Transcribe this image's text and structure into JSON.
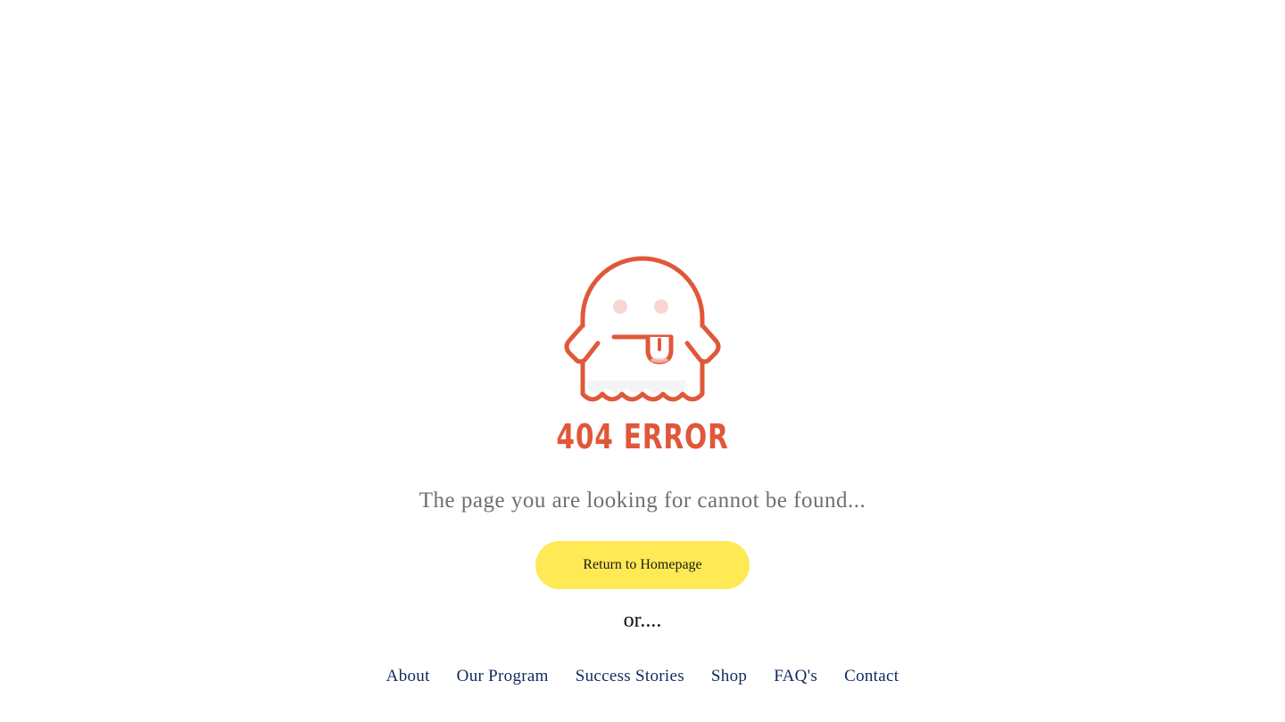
{
  "error": {
    "heading": "404 ERROR",
    "message": "The page you are looking for cannot be found..."
  },
  "actions": {
    "home_button_label": "Return to Homepage",
    "or_text": "or...."
  },
  "nav": {
    "items": [
      {
        "label": "About"
      },
      {
        "label": "Our Program"
      },
      {
        "label": "Success Stories"
      },
      {
        "label": "Shop"
      },
      {
        "label": "FAQ's"
      },
      {
        "label": "Contact"
      }
    ]
  },
  "colors": {
    "accent": "#e0573a",
    "button_bg": "#ffe955",
    "nav_link": "#0f2a5c",
    "message_text": "#6f6f6f",
    "ghost_eyes": "#f7d6d2"
  },
  "icons": {
    "illustration": "ghost-icon"
  }
}
